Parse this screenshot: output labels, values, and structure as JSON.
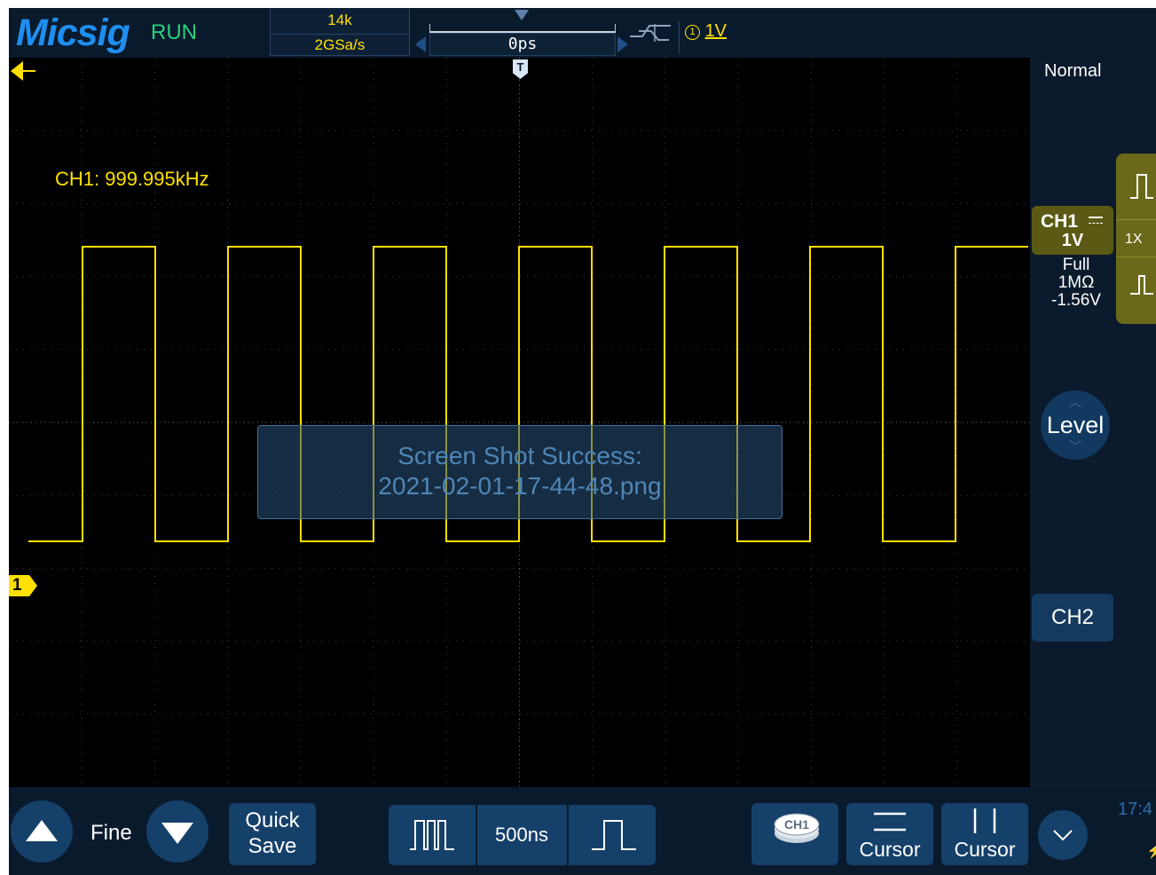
{
  "header": {
    "brand": "Micsig",
    "run_state": "RUN",
    "memory_depth": "14k",
    "sample_rate": "2GSa/s",
    "trigger_position": "0ps",
    "trigger_channel_symbol": "1",
    "trigger_level": "1V",
    "trigger_marker": "T"
  },
  "waveform": {
    "frequency_readout": "CH1: 999.995kHz",
    "channel_marker": "1",
    "toast_line1": "Screen Shot Success:",
    "toast_line2": "2021-02-01-17-44-48.png"
  },
  "right_panel": {
    "trigger_mode": "Normal",
    "ch1_label": "CH1",
    "ch1_scale": "1V",
    "ch1_bandwidth": "Full",
    "ch1_impedance": "1MΩ",
    "ch1_offset": "-1.56V",
    "probe_factor": "1X",
    "level_label": "Level",
    "ch2_label": "CH2"
  },
  "bottom_bar": {
    "fine_label": "Fine",
    "quick_save_line1": "Quick",
    "quick_save_line2": "Save",
    "timebase": "500ns",
    "channel_badge": "CH1",
    "cursor_h_label": "Cursor",
    "cursor_v_label": "Cursor",
    "clock": "17:4"
  },
  "colors": {
    "ch1": "#ffe000",
    "panel_bg": "#0b1a2c",
    "button_bg": "#15406a",
    "accent_logo": "#1e8ff0",
    "run_green": "#28d07a"
  }
}
